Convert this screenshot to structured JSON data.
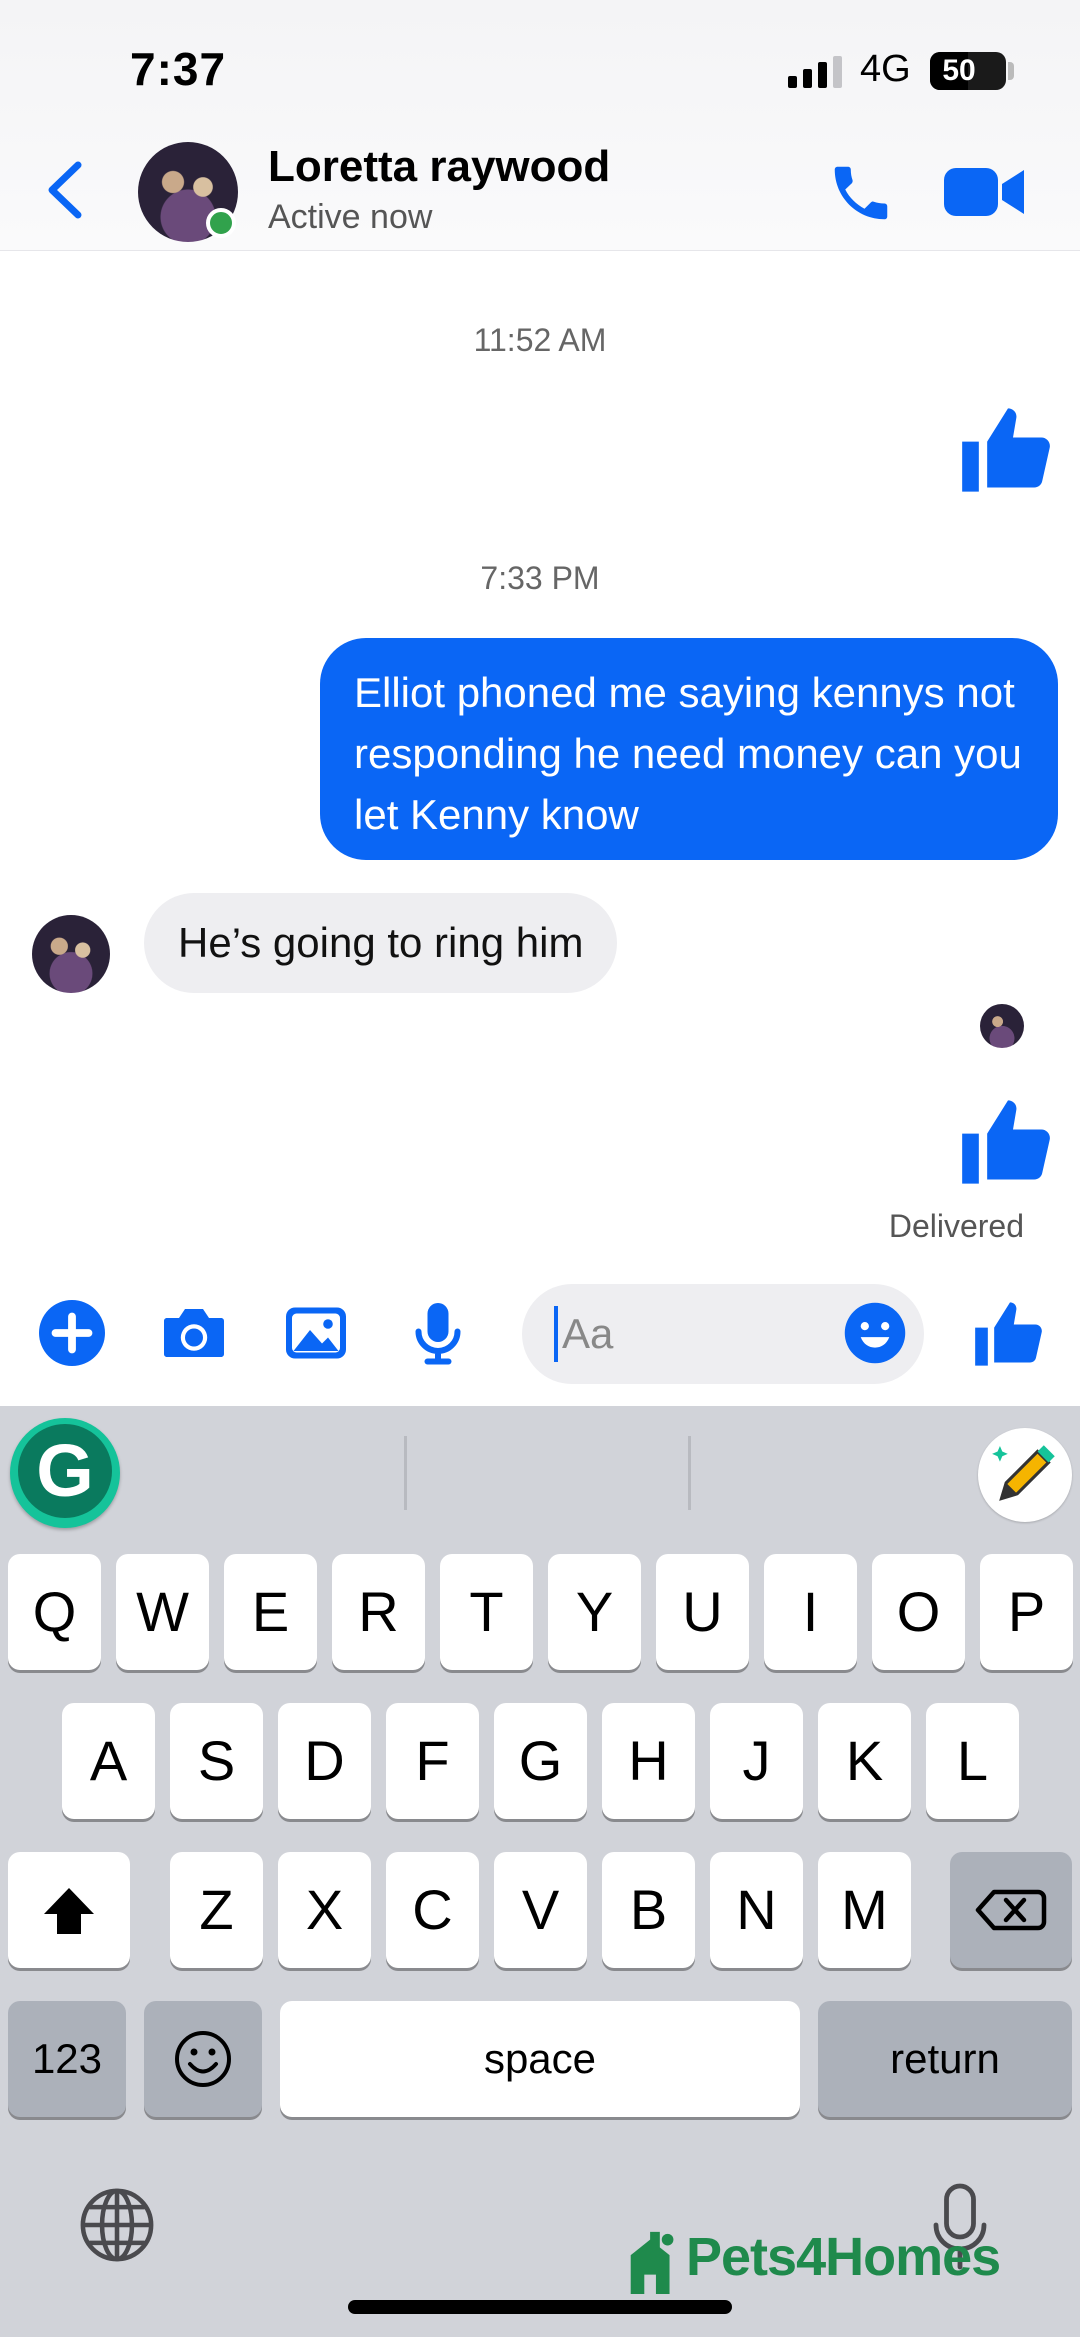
{
  "status_bar": {
    "time": "7:37",
    "network": "4G",
    "battery": "50",
    "battery_level": 0.5
  },
  "header": {
    "contact_name": "Loretta raywood",
    "status": "Active now"
  },
  "messages": {
    "timestamp_1": "11:52 AM",
    "timestamp_2": "7:33 PM",
    "sent_text": "Elliot phoned me saying kennys not responding he need money can you let Kenny know",
    "received_text": "He’s going to ring him",
    "delivered": "Delivered"
  },
  "composer": {
    "placeholder": "Aa"
  },
  "keyboard": {
    "row1": [
      "Q",
      "W",
      "E",
      "R",
      "T",
      "Y",
      "U",
      "I",
      "O",
      "P"
    ],
    "row2": [
      "A",
      "S",
      "D",
      "F",
      "G",
      "H",
      "J",
      "K",
      "L"
    ],
    "row3": [
      "Z",
      "X",
      "C",
      "V",
      "B",
      "N",
      "M"
    ],
    "numbers_label": "123",
    "space_label": "space",
    "return_label": "return",
    "grammarly_letter": "G"
  },
  "watermark": "Pets4Homes",
  "colors": {
    "accent": "#0a66f5",
    "online": "#31a24c",
    "received_bubble": "#eeeef1",
    "grammarly": "#15c39a"
  },
  "icons": [
    "back-chevron-icon",
    "phone-icon",
    "video-camera-icon",
    "thumbs-up-icon",
    "plus-circle-icon",
    "camera-icon",
    "photo-icon",
    "microphone-icon",
    "emoji-icon",
    "shift-icon",
    "backspace-icon",
    "globe-icon",
    "pencil-icon"
  ]
}
